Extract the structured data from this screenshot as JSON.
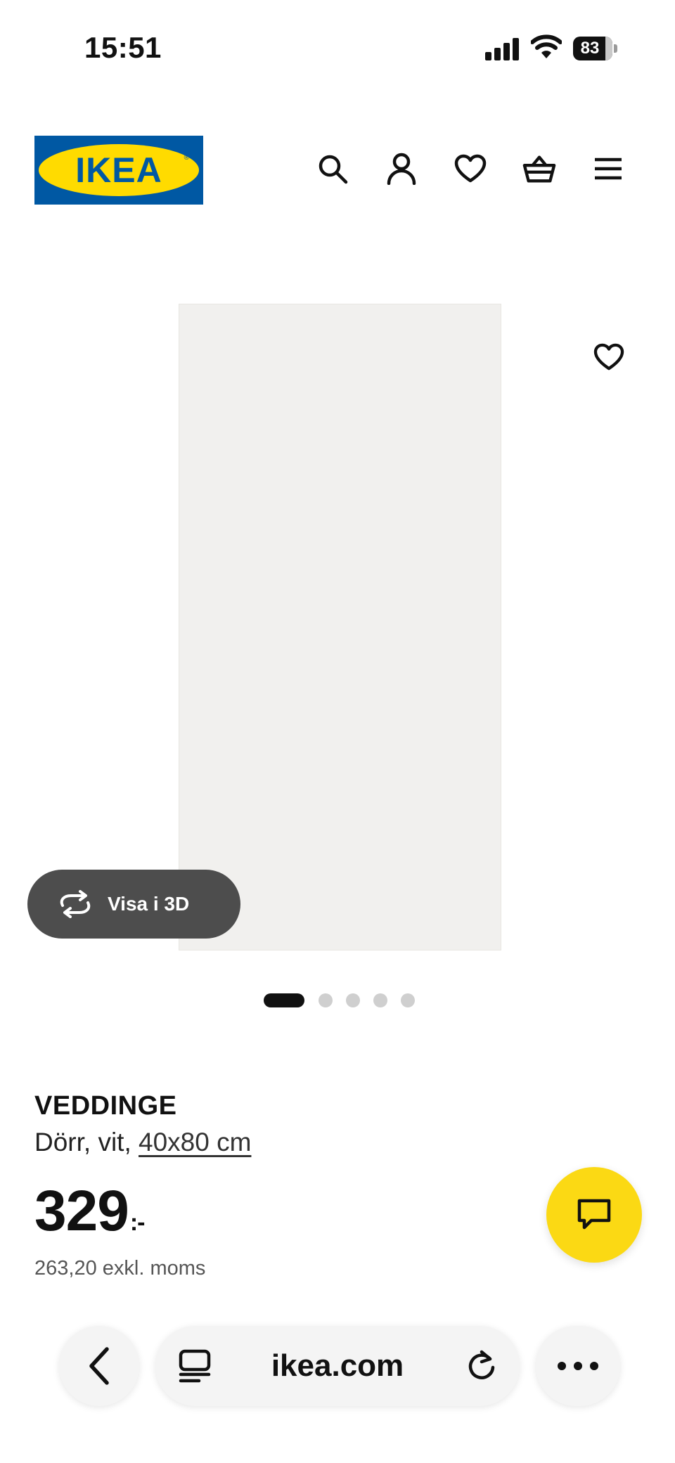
{
  "status_bar": {
    "time": "15:51",
    "battery": "83"
  },
  "header": {
    "logo_text": "IKEA",
    "logo_reg": "®",
    "icons": [
      "search-icon",
      "user-icon",
      "heart-icon",
      "basket-icon",
      "menu-icon"
    ]
  },
  "gallery": {
    "view_3d_label": "Visa i 3D",
    "image_count": 5,
    "active_index": 0
  },
  "product": {
    "name": "VEDDINGE",
    "desc_prefix": "Dörr, vit, ",
    "size_link": "40x80 cm",
    "price_main": "329",
    "price_suffix": ":-",
    "price_ex_vat": "263,20 exkl. moms"
  },
  "browser": {
    "domain": "ikea.com"
  },
  "colors": {
    "ikea_blue": "#0058a3",
    "ikea_yellow": "#ffdb00",
    "chat_yellow": "#fbd914",
    "view3d_bg": "#4d4d4d"
  }
}
